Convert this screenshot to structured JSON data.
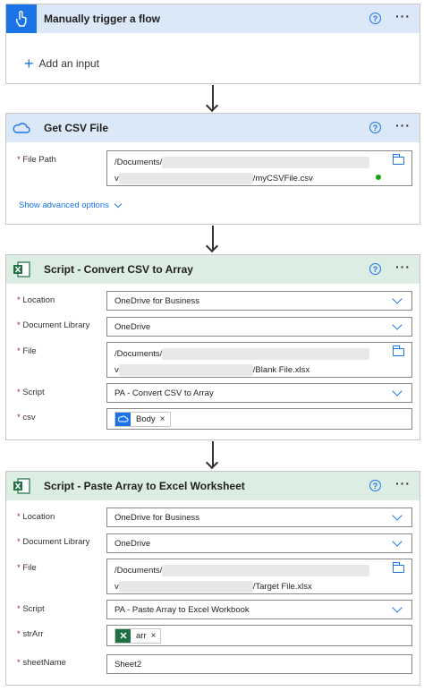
{
  "steps": [
    {
      "title": "Manually trigger a flow",
      "icon": "touch-icon",
      "add_input_label": "Add an input"
    },
    {
      "title": "Get CSV File",
      "icon": "onedrive-icon",
      "fields": {
        "file_path_label": "File Path",
        "file_path_line1": "/Documents/",
        "file_path_line2_prefix": "v",
        "file_path_line2_suffix": "/myCSVFile.csv"
      },
      "advanced_link": "Show advanced options"
    },
    {
      "title": "Script - Convert CSV to Array",
      "icon": "excel-icon",
      "fields": {
        "location_label": "Location",
        "location_value": "OneDrive for Business",
        "library_label": "Document Library",
        "library_value": "OneDrive",
        "file_label": "File",
        "file_line1": "/Documents/",
        "file_line2_prefix": "v",
        "file_line2_suffix": "/Blank File.xlsx",
        "script_label": "Script",
        "script_value": "PA - Convert CSV to Array",
        "csv_label": "csv",
        "csv_token": "Body"
      }
    },
    {
      "title": "Script - Paste Array to Excel Worksheet",
      "icon": "excel-icon",
      "fields": {
        "location_label": "Location",
        "location_value": "OneDrive for Business",
        "library_label": "Document Library",
        "library_value": "OneDrive",
        "file_label": "File",
        "file_line1": "/Documents/",
        "file_line2_prefix": "v",
        "file_line2_suffix": "/Target File.xlsx",
        "script_label": "Script",
        "script_value": "PA - Paste Array to Excel Workbook",
        "strarr_label": "strArr",
        "strarr_token": "arr",
        "sheetname_label": "sheetName",
        "sheetname_value": "Sheet2"
      }
    }
  ],
  "common": {
    "help_glyph": "?",
    "more_glyph": "···",
    "required_mark": "*",
    "token_remove": "×",
    "add_glyph": "+"
  },
  "colors": {
    "accent": "#1b73e8",
    "trigger_header": "#dbe8f7",
    "excel_header": "#dcede3",
    "excel_green": "#1e7145",
    "required": "#a4262c"
  }
}
